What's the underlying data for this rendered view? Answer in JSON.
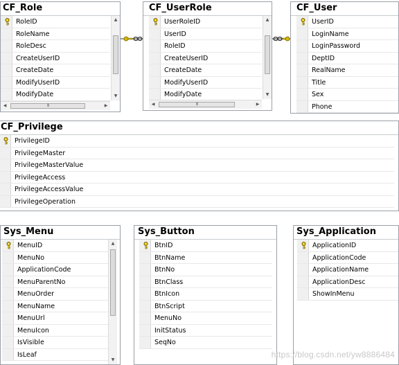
{
  "tables": {
    "cf_role": {
      "title": "CF_Role",
      "columns": [
        "RoleID",
        "RoleName",
        "RoleDesc",
        "CreateUserID",
        "CreateDate",
        "ModifyUserID",
        "ModifyDate"
      ]
    },
    "cf_userrole": {
      "title": "CF_UserRole",
      "columns": [
        "UserRoleID",
        "UserID",
        "RoleID",
        "CreateUserID",
        "CreateDate",
        "ModifyUserID",
        "ModifyDate"
      ]
    },
    "cf_user": {
      "title": "CF_User",
      "columns": [
        "UserID",
        "LoginName",
        "LoginPassword",
        "DeptID",
        "RealName",
        "Title",
        "Sex",
        "Phone"
      ]
    },
    "cf_privilege": {
      "title": "CF_Privilege",
      "columns": [
        "PrivilegeID",
        "PrivilegeMaster",
        "PrivilegeMasterValue",
        "PrivilegeAccess",
        "PrivilegeAccessValue",
        "PrivilegeOperation"
      ]
    },
    "sys_menu": {
      "title": "Sys_Menu",
      "columns": [
        "MenuID",
        "MenuNo",
        "ApplicationCode",
        "MenuParentNo",
        "MenuOrder",
        "MenuName",
        "MenuUrl",
        "MenuIcon",
        "IsVisible",
        "IsLeaf"
      ]
    },
    "sys_button": {
      "title": "Sys_Button",
      "columns": [
        "BtnID",
        "BtnName",
        "BtnNo",
        "BtnClass",
        "BtnIcon",
        "BtnScript",
        "MenuNo",
        "InitStatus",
        "SeqNo"
      ]
    },
    "sys_application": {
      "title": "Sys_Application",
      "columns": [
        "ApplicationID",
        "ApplicationCode",
        "ApplicationName",
        "ApplicationDesc",
        "ShowInMenu"
      ]
    }
  },
  "watermark": "https://blog.csdn.net/yw8886484",
  "colors": {
    "key": "#d8b800",
    "border": "#9aa0a6",
    "relationship": "#333333"
  }
}
